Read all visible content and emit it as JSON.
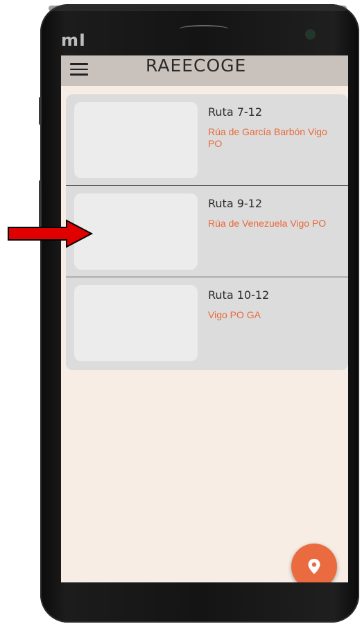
{
  "device": {
    "brand_logo": "mI"
  },
  "appbar": {
    "title": "RAEECOGE",
    "menu_icon": "hamburger-menu-icon"
  },
  "routes": [
    {
      "title": "Ruta 7-12",
      "address": "Rúa de García Barbón Vigo PO"
    },
    {
      "title": "Ruta 9-12",
      "address": "Rúa de Venezuela Vigo PO"
    },
    {
      "title": "Ruta 10-12",
      "address": "Vigo PO GA"
    }
  ],
  "fab": {
    "icon": "map-pin-icon"
  },
  "colors": {
    "accent": "#ea6b3f",
    "address_text": "#e8683a",
    "screen_bg": "#f7ede4",
    "appbar_bg": "#c9c1bb",
    "list_bg": "#dcdcdc",
    "annotation_arrow": "#e00000"
  }
}
